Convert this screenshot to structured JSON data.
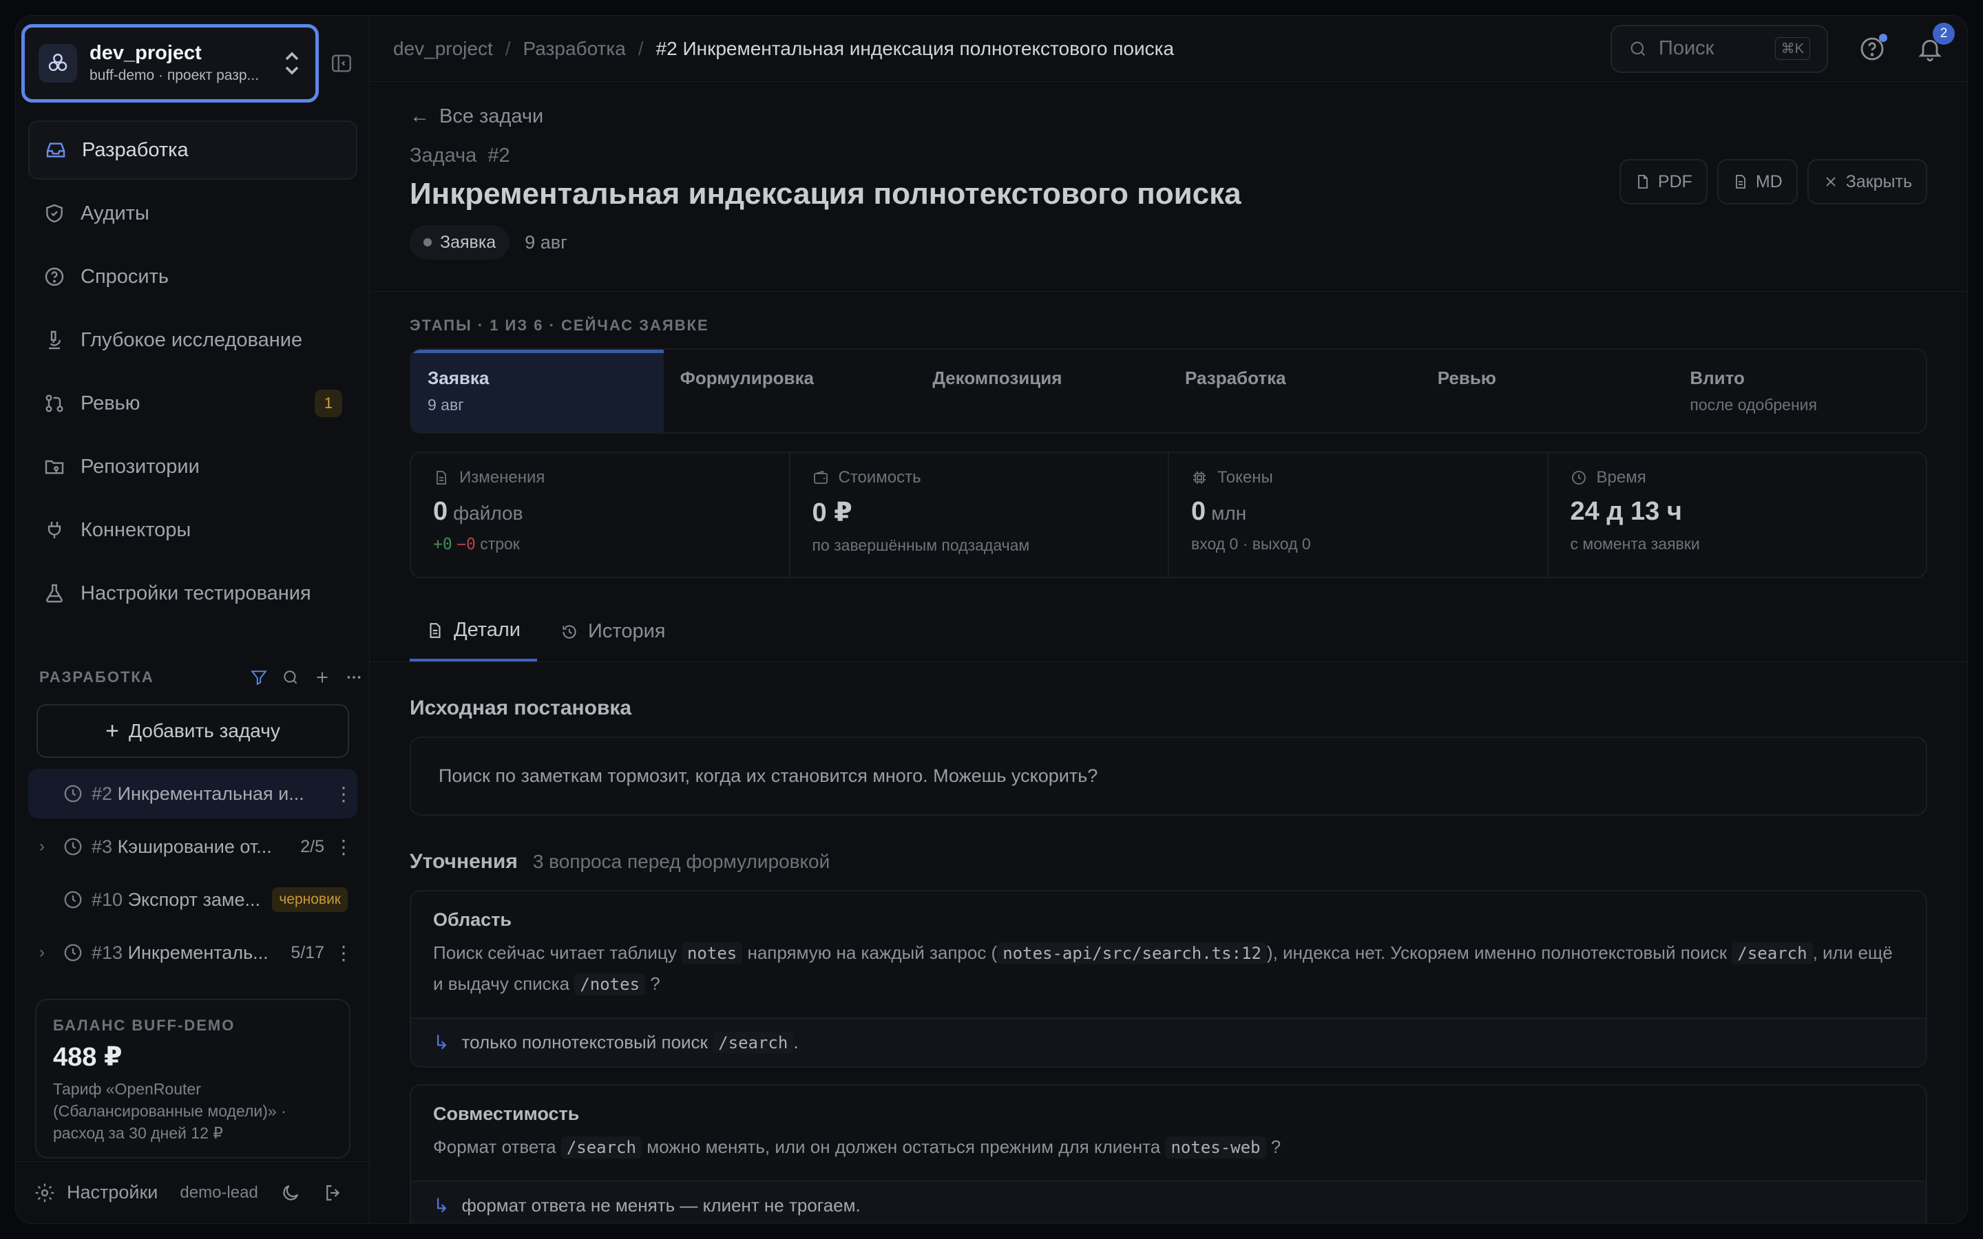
{
  "project": {
    "name": "dev_project",
    "subtitle": "buff-demo · проект разр..."
  },
  "nav": [
    {
      "label": "Разработка",
      "icon": "inbox-icon",
      "active": true
    },
    {
      "label": "Аудиты",
      "icon": "shield-icon"
    },
    {
      "label": "Спросить",
      "icon": "help-circle-icon"
    },
    {
      "label": "Глубокое исследование",
      "icon": "microscope-icon"
    },
    {
      "label": "Ревью",
      "icon": "git-pull-request-icon",
      "badge": "1"
    },
    {
      "label": "Репозитории",
      "icon": "folder-git-icon"
    },
    {
      "label": "Коннекторы",
      "icon": "plug-icon"
    },
    {
      "label": "Настройки тестирования",
      "icon": "flask-icon"
    }
  ],
  "section": {
    "title": "РАЗРАБОТКА",
    "add_task": "Добавить задачу"
  },
  "tasks": [
    {
      "num": "#2",
      "title": "Инкрементальная и...",
      "count": "",
      "draft": ""
    },
    {
      "num": "#3",
      "title": "Кэширование от...",
      "count": "2/5",
      "draft": ""
    },
    {
      "num": "#10",
      "title": "Экспорт заме...",
      "count": "",
      "draft": "черновик"
    },
    {
      "num": "#13",
      "title": "Инкременталь...",
      "count": "5/17",
      "draft": ""
    }
  ],
  "balance": {
    "label": "БАЛАНС BUFF-DEMO",
    "value": "488 ₽",
    "desc": "Тариф «OpenRouter (Сбалансированные модели)» · расход за 30 дней 12 ₽"
  },
  "footer": {
    "settings": "Настройки",
    "user": "demo-lead"
  },
  "breadcrumbs": {
    "b1": "dev_project",
    "b2": "Разработка",
    "b3": "#2 Инкрементальная индексация полнотекстового поиска"
  },
  "search": {
    "placeholder": "Поиск",
    "shortcut": "⌘K"
  },
  "notifications": {
    "count": "2"
  },
  "task": {
    "back": "Все задачи",
    "label": "Задача  #2",
    "title": "Инкрементальная индексация полнотекстового поиска",
    "status": "Заявка",
    "date": "9 авг"
  },
  "actions": {
    "pdf": "PDF",
    "md": "MD",
    "close": "Закрыть"
  },
  "stages": {
    "label": "ЭТАПЫ · 1 ИЗ 6 · СЕЙЧАС ЗАЯВКЕ",
    "items": [
      {
        "name": "Заявка",
        "sub": "9 авг"
      },
      {
        "name": "Формулировка",
        "sub": ""
      },
      {
        "name": "Декомпозиция",
        "sub": ""
      },
      {
        "name": "Разработка",
        "sub": ""
      },
      {
        "name": "Ревью",
        "sub": ""
      },
      {
        "name": "Влито",
        "sub": "после одобрения"
      }
    ]
  },
  "stats": {
    "changes": {
      "label": "Изменения",
      "value": "0",
      "unit": "файлов",
      "plus": "+0",
      "minus": "−0",
      "lines": "строк"
    },
    "cost": {
      "label": "Стоимость",
      "value": "0 ₽",
      "sub": "по завершённым подзадачам"
    },
    "tokens": {
      "label": "Токены",
      "value": "0",
      "unit": "млн",
      "sub": "вход 0 · выход 0"
    },
    "time": {
      "label": "Время",
      "value": "24 д 13 ч",
      "sub": "с момента заявки"
    }
  },
  "tabs": {
    "details": "Детали",
    "history": "История"
  },
  "original": {
    "title": "Исходная постановка",
    "text": "Поиск по заметкам тормозит, когда их становится много. Можешь ускорить?"
  },
  "clarifications": {
    "title": "Уточнения",
    "subtitle": "3 вопроса перед формулировкой",
    "q1": {
      "title": "Область",
      "t1": "Поиск сейчас читает таблицу",
      "c1": "notes",
      "t2": "напрямую на каждый запрос (",
      "c2": "notes-api/src/search.ts:12",
      "t3": "), индекса нет. Ускоряем именно полнотекстовый поиск",
      "c3": "/search",
      "t4": ", или ещё и выдачу списка",
      "c4": "/notes",
      "t5": "?",
      "a1": "только полнотекстовый поиск",
      "ac": "/search",
      "a2": "."
    },
    "q2": {
      "title": "Совместимость",
      "t1": "Формат ответа",
      "c1": "/search",
      "t2": "можно менять, или он должен остаться прежним для клиента",
      "c2": "notes-web",
      "t3": "?",
      "a1": "формат ответа не менять — клиент не трогаем."
    }
  },
  "colors": {
    "accent": "#5d86ea",
    "badge": "#d4a53b",
    "plus": "#3e8f5b",
    "minus": "#b04545"
  }
}
